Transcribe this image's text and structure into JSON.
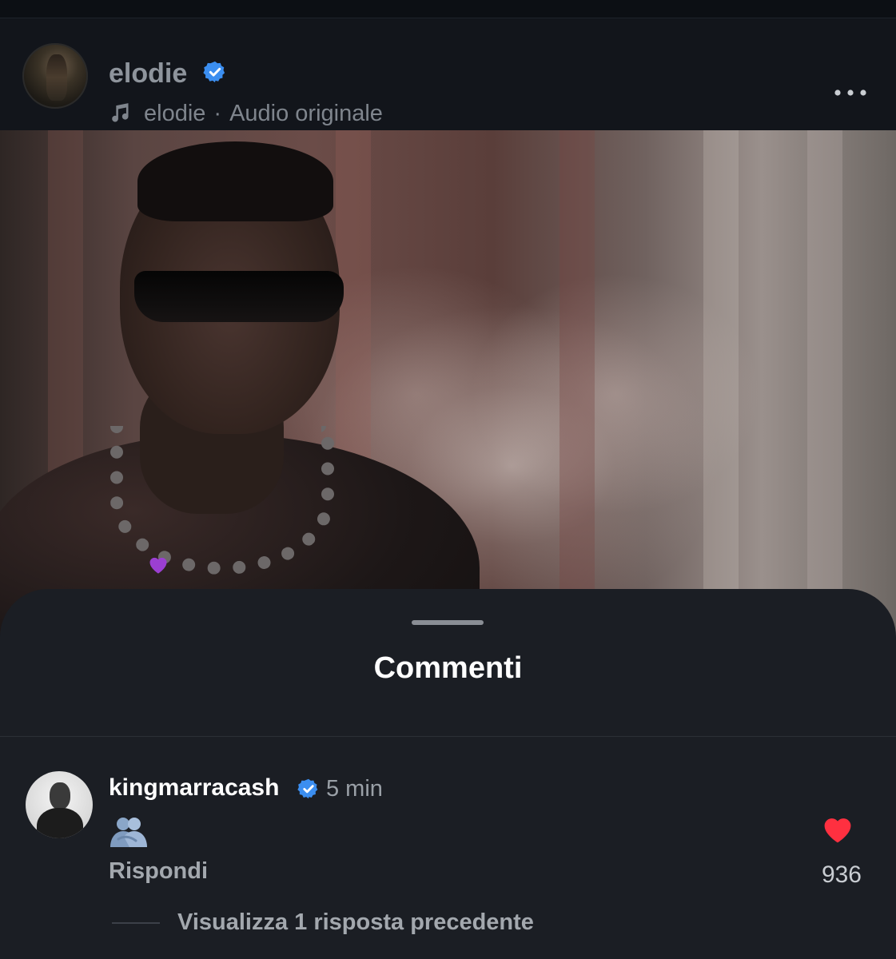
{
  "post": {
    "username": "elodie",
    "audio_author": "elodie",
    "audio_separator": "·",
    "audio_label": "Audio originale",
    "verified": true,
    "icons": {
      "music": "music-note-icon",
      "more": "more-horizontal-icon",
      "verified": "verified-badge-icon"
    }
  },
  "comments_sheet": {
    "title": "Commenti"
  },
  "comment": {
    "username": "kingmarracash",
    "verified": true,
    "time": "5 min",
    "body_emoji": "people-hugging-emoji",
    "reply_label": "Rispondi",
    "like_count": "936",
    "liked": true,
    "view_replies_label": "Visualizza 1 risposta precedente"
  },
  "colors": {
    "verified_blue": "#3b8ef0",
    "like_red": "#ff3040",
    "floating_heart": "#9b3fd1"
  }
}
